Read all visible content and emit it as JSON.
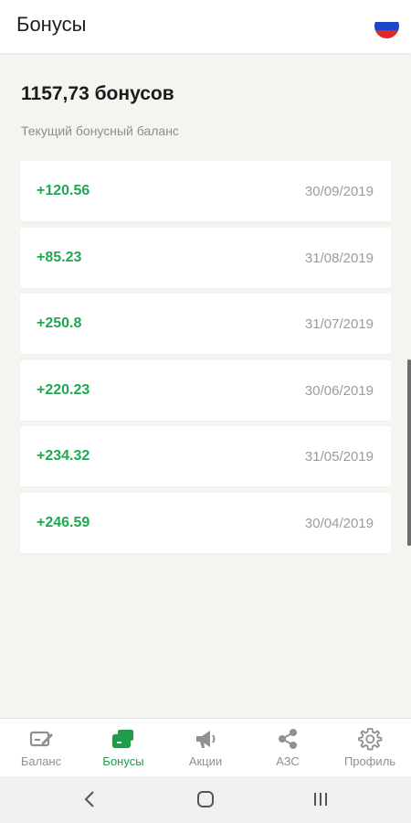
{
  "header": {
    "title": "Бонусы"
  },
  "summary": {
    "balance": "1157,73 бонусов",
    "caption": "Текущий бонусный баланс"
  },
  "transactions": [
    {
      "amount": "+120.56",
      "date": "30/09/2019"
    },
    {
      "amount": "+85.23",
      "date": "31/08/2019"
    },
    {
      "amount": "+250.8",
      "date": "31/07/2019"
    },
    {
      "amount": "+220.23",
      "date": "30/06/2019"
    },
    {
      "amount": "+234.32",
      "date": "31/05/2019"
    },
    {
      "amount": "+246.59",
      "date": "30/04/2019"
    }
  ],
  "nav": {
    "items": [
      {
        "label": "Баланс",
        "icon": "balance-edit-icon"
      },
      {
        "label": "Бонусы",
        "icon": "bonus-cards-icon"
      },
      {
        "label": "Акции",
        "icon": "megaphone-icon"
      },
      {
        "label": "АЗС",
        "icon": "share-nodes-icon"
      },
      {
        "label": "Профиль",
        "icon": "gear-icon"
      }
    ],
    "active_index": 1
  },
  "system_nav": {
    "icons": [
      "back-icon",
      "home-icon",
      "recents-icon"
    ]
  },
  "colors": {
    "accent_green": "#1e9e4a",
    "amount_green": "#1ea850",
    "background": "#f2f5f0",
    "inactive_gray": "#8e918e",
    "flag_white": "#ffffff",
    "flag_blue": "#1c45c9",
    "flag_red": "#e2262b"
  }
}
